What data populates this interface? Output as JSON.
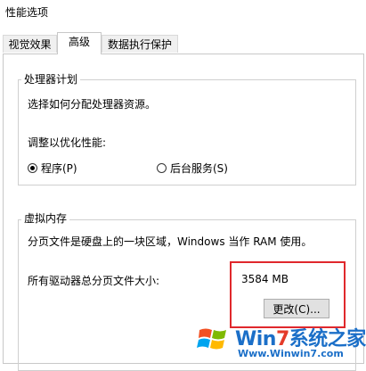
{
  "window": {
    "title": "性能选项"
  },
  "tabs": [
    {
      "label": "视觉效果"
    },
    {
      "label": "高级"
    },
    {
      "label": "数据执行保护"
    }
  ],
  "processor": {
    "group_title": "处理器计划",
    "description": "选择如何分配处理器资源。",
    "adjust_label": "调整以优化性能:",
    "options": [
      {
        "label": "程序(P)",
        "checked": true
      },
      {
        "label": "后台服务(S)",
        "checked": false
      }
    ]
  },
  "virtual_memory": {
    "group_title": "虚拟内存",
    "description": "分页文件是硬盘上的一块区域，Windows 当作 RAM 使用。",
    "total_label": "所有驱动器总分页文件大小:",
    "total_value": "3584 MB",
    "change_button": "更改(C)..."
  },
  "watermark": {
    "brand_prefix": "Win",
    "brand_seven": "7",
    "brand_suffix": "系统之家",
    "url": "Www.Winwin7.com"
  },
  "colors": {
    "highlight": "#e0282c",
    "brand_blue": "#1b6fc8",
    "brand_red": "#e43b2a"
  }
}
